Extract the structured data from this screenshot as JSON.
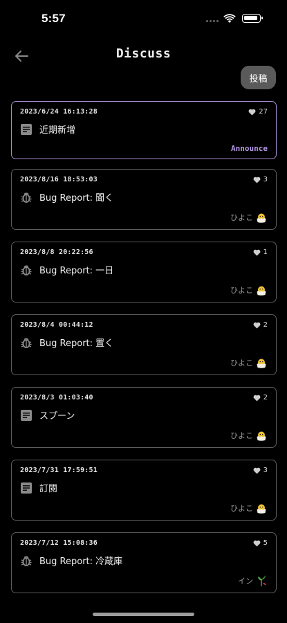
{
  "status": {
    "time": "5:57"
  },
  "header": {
    "title": "Discuss",
    "post_button": "投稿"
  },
  "posts": [
    {
      "date": "2023/6/24 16:13:28",
      "likes": "27",
      "icon": "document-icon",
      "title": "近期新增",
      "tag": "Announce"
    },
    {
      "date": "2023/8/16 18:53:03",
      "likes": "3",
      "icon": "bug-icon",
      "title": "Bug Report: 聞く",
      "author": "ひよこ",
      "avatar": "chick-avatar"
    },
    {
      "date": "2023/8/8 20:22:56",
      "likes": "1",
      "icon": "bug-icon",
      "title": "Bug Report: 一日",
      "author": "ひよこ",
      "avatar": "chick-avatar"
    },
    {
      "date": "2023/8/4 00:44:12",
      "likes": "2",
      "icon": "bug-icon",
      "title": "Bug Report: 置く",
      "author": "ひよこ",
      "avatar": "chick-avatar"
    },
    {
      "date": "2023/8/3 01:03:40",
      "likes": "2",
      "icon": "document-icon",
      "title": "スプーン",
      "author": "ひよこ",
      "avatar": "chick-avatar"
    },
    {
      "date": "2023/7/31 17:59:51",
      "likes": "3",
      "icon": "document-icon",
      "title": "訂閱",
      "author": "ひよこ",
      "avatar": "chick-avatar"
    },
    {
      "date": "2023/7/12 15:08:36",
      "likes": "5",
      "icon": "bug-icon",
      "title": "Bug Report: 冷蔵庫",
      "author": "イン",
      "avatar": "plant-avatar"
    }
  ],
  "colors": {
    "announce_border": "#a48dd0",
    "announce_tag": "#b79be8",
    "card_border": "#5d5d5d",
    "post_button_bg": "#5a5a5a"
  }
}
